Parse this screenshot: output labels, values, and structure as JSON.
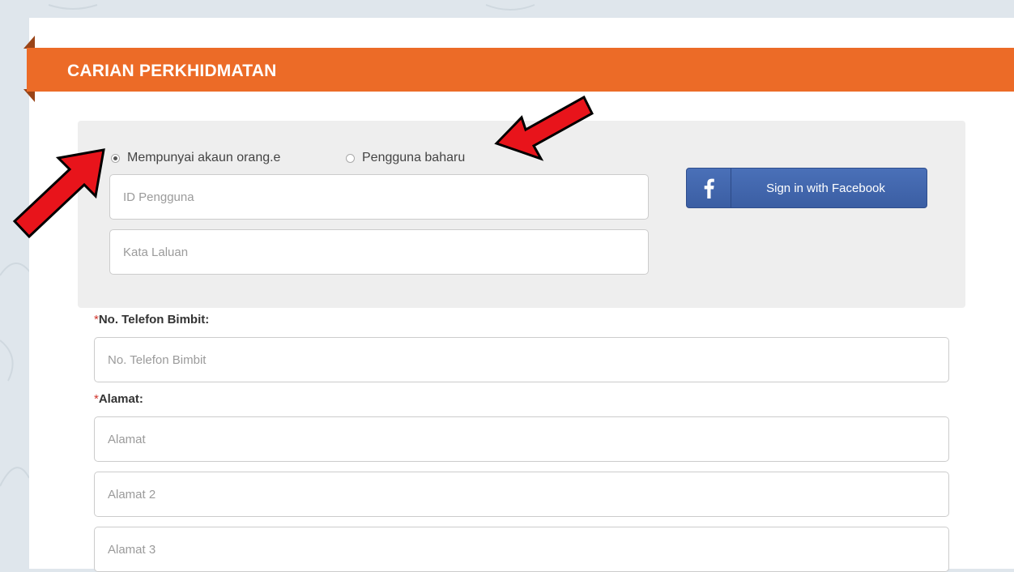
{
  "header": {
    "title": "CARIAN PERKHIDMATAN"
  },
  "account_choice": {
    "options": [
      {
        "label": "Mempunyai akaun orang.e",
        "checked": true
      },
      {
        "label": "Pengguna baharu",
        "checked": false
      }
    ]
  },
  "login": {
    "user_id_placeholder": "ID Pengguna",
    "password_placeholder": "Kata Laluan"
  },
  "facebook": {
    "label": "Sign in with Facebook",
    "color": "#3b5ea3"
  },
  "form": {
    "required_mark": "*",
    "phone_label": "No. Telefon Bimbit:",
    "phone_placeholder": "No. Telefon Bimbit",
    "address_label": "Alamat:",
    "address1_placeholder": "Alamat",
    "address2_placeholder": "Alamat 2",
    "address3_placeholder": "Alamat 3"
  },
  "colors": {
    "accent": "#ec6b27",
    "annotation_arrow": "#e8141b"
  }
}
